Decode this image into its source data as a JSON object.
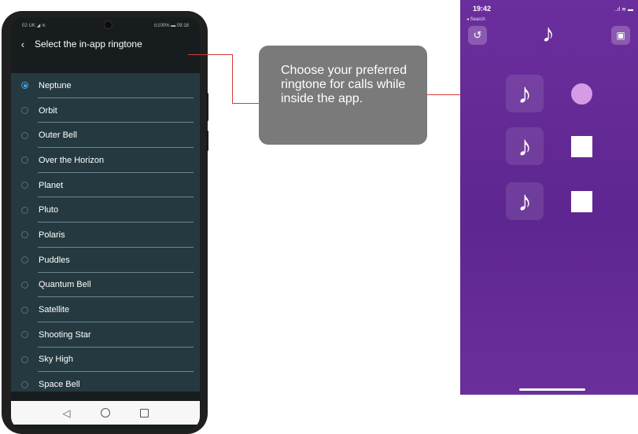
{
  "android": {
    "status_left": "02·UK ◢ ≋",
    "status_right": "⊙100% ▬ 09:18",
    "header_title": "Select the in-app ringtone",
    "selected": "Neptune",
    "ringtones": [
      "Neptune",
      "Orbit",
      "Outer Bell",
      "Over the Horizon",
      "Planet",
      "Pluto",
      "Polaris",
      "Puddles",
      "Quantum Bell",
      "Satellite",
      "Shooting Star",
      "Sky High",
      "Space Bell"
    ],
    "icons": {
      "back": "‹",
      "nav_back": "◁"
    }
  },
  "callout": {
    "text": "Choose your preferred ringtone for calls while inside the app."
  },
  "ios": {
    "time": "19:42",
    "back_link": "◂ Search",
    "status_icons": "..ıl ≋ ▬",
    "note_glyph": "♪",
    "undo_glyph": "↺",
    "save_glyph": "💾",
    "tones": [
      {
        "glyph": "♪",
        "selected": true
      },
      {
        "glyph": "♪",
        "selected": false
      },
      {
        "glyph": "♪",
        "selected": false
      }
    ]
  }
}
